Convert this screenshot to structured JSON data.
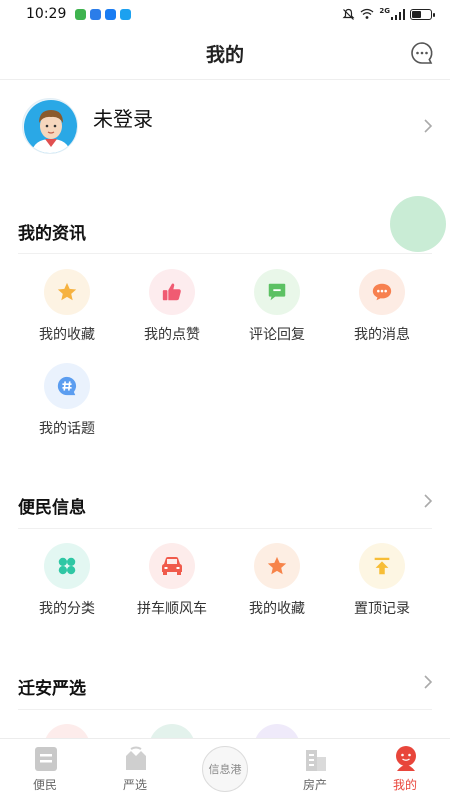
{
  "status_bar": {
    "time": "10:29",
    "network": "2G",
    "battery_level": 0.55,
    "app_icon_colors": [
      "#3fb34f",
      "#2b7de9",
      "#1a7cf2",
      "#1ca1f0"
    ]
  },
  "header": {
    "title": "我的",
    "message_icon": "chat-bubble-icon"
  },
  "profile": {
    "login_text": "未登录",
    "avatar_icon": "default-avatar-icon"
  },
  "sections": {
    "news": {
      "title": "我的资讯",
      "items": [
        {
          "label": "我的收藏",
          "icon": "star-icon",
          "bg": "#fdf3e3",
          "color": "#f6b240"
        },
        {
          "label": "我的点赞",
          "icon": "thumbs-up-icon",
          "bg": "#fdecee",
          "color": "#f05b72"
        },
        {
          "label": "评论回复",
          "icon": "comment-icon",
          "bg": "#e9f7e9",
          "color": "#5cc163"
        },
        {
          "label": "我的消息",
          "icon": "message-icon",
          "bg": "#fdece4",
          "color": "#f7804f"
        },
        {
          "label": "我的话题",
          "icon": "hashtag-icon",
          "bg": "#eaf2fd",
          "color": "#5b9df0"
        }
      ]
    },
    "convenience": {
      "title": "便民信息",
      "items": [
        {
          "label": "我的分类",
          "icon": "category-icon",
          "bg": "#e3f7f2",
          "color": "#2fc7a4"
        },
        {
          "label": "拼车顺风车",
          "icon": "car-icon",
          "bg": "#fdeceb",
          "color": "#f05a4b"
        },
        {
          "label": "我的收藏",
          "icon": "star-icon",
          "bg": "#fdeee3",
          "color": "#f7844a"
        },
        {
          "label": "置顶记录",
          "icon": "pin-top-icon",
          "bg": "#fdf6e3",
          "color": "#f7bd36"
        }
      ]
    },
    "selection": {
      "title": "迁安严选"
    }
  },
  "tabbar": {
    "tabs": [
      {
        "label": "便民",
        "icon": "convenience-icon"
      },
      {
        "label": "严选",
        "icon": "selection-icon"
      },
      {
        "label": "信息港",
        "icon": "info-port-icon"
      },
      {
        "label": "房产",
        "icon": "building-icon"
      },
      {
        "label": "我的",
        "icon": "profile-icon"
      }
    ],
    "active_color": "#e8463b"
  }
}
